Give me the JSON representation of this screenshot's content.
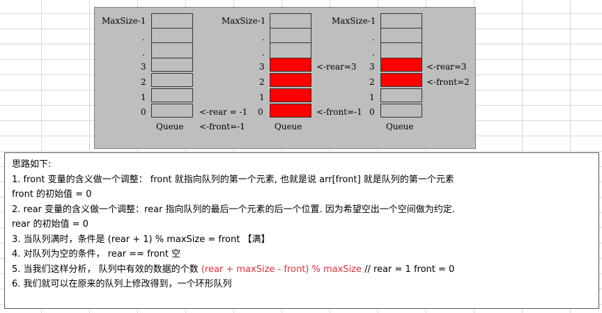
{
  "diagram": {
    "queues": [
      {
        "labels": {
          "max": "MaxSize-1",
          "dot1": ".",
          "dot2": ".",
          "r3": "3",
          "r2": "2",
          "r1": "1",
          "r0": "0"
        },
        "filled": [
          false,
          false,
          false,
          false
        ],
        "pointers": [
          "<-rear = -1",
          "<-front=-1"
        ],
        "caption": "Queue"
      },
      {
        "labels": {
          "max": "MaxSize-1",
          "dot1": ".",
          "dot2": ".",
          "r3": "3",
          "r2": "2",
          "r1": "1",
          "r0": "0"
        },
        "filled": [
          true,
          true,
          true,
          true
        ],
        "pointers": [
          "<-rear=3",
          "<-front=-1"
        ],
        "caption": "Queue"
      },
      {
        "labels": {
          "max": "MaxSize-1",
          "dot1": ".",
          "dot2": ".",
          "r3": "3",
          "r2": "2",
          "r1": "1",
          "r0": "0"
        },
        "filled": [
          false,
          false,
          true,
          true
        ],
        "pointers": [
          "<-rear=3",
          "<-front=2"
        ],
        "caption": "Queue"
      }
    ],
    "colors": {
      "filled": "#ff0000",
      "background": "#bebebe"
    }
  },
  "notes": {
    "title": "思路如下:",
    "l1": "1.  front 变量的含义做一个调整： front 就指向队列的第一个元素, 也就是说 arr[front] 就是队列的第一个元素",
    "l2": "front 的初始值 = 0",
    "l3": "2.  rear 变量的含义做一个调整：rear 指向队列的最后一个元素的后一个位置. 因为希望空出一个空间做为约定.",
    "l4": "rear 的初始值 = 0",
    "l5": "3. 当队列满时，条件是  (rear  + 1) % maxSize = front 【满】",
    "l6": "4. 对队列为空的条件， rear == front 空",
    "l7_prefix": "5. 当我们这样分析， 队列中有效的数据的个数  ",
    "l7_formula": "(rear + maxSize - front) % maxSize",
    "l7_comment": "   // rear = 1 front = 0",
    "l8": "6. 我们就可以在原来的队列上修改得到，一个环形队列"
  }
}
